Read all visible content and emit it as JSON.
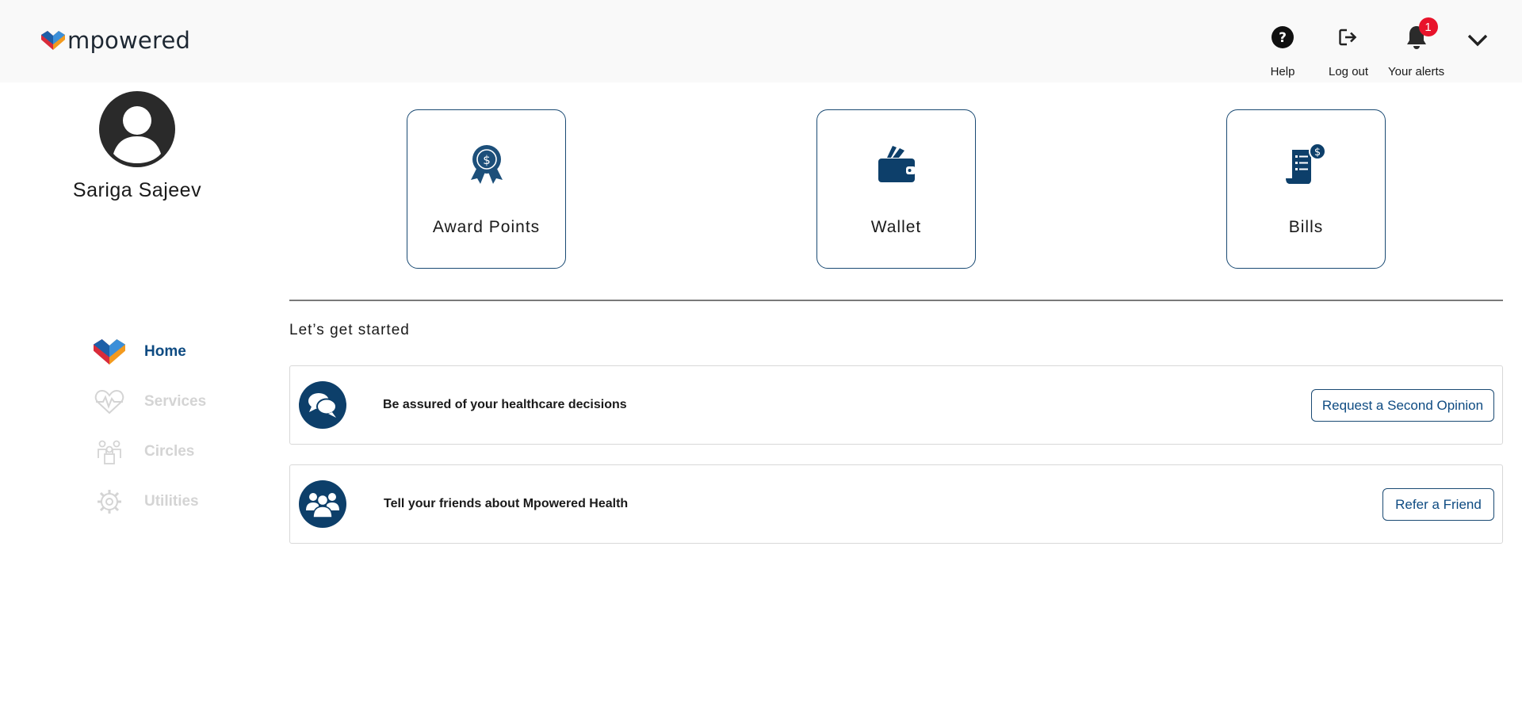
{
  "app": {
    "logo_text": "mpowered"
  },
  "header": {
    "help_label": "Help",
    "logout_label": "Log out",
    "alerts_label": "Your alerts",
    "alerts_count": "1"
  },
  "profile": {
    "name": "Sariga Sajeev"
  },
  "nav": {
    "items": [
      {
        "label": "Home",
        "icon": "heart-logo-icon",
        "active": true
      },
      {
        "label": "Services",
        "icon": "heart-pulse-icon",
        "active": false
      },
      {
        "label": "Circles",
        "icon": "people-icon",
        "active": false
      },
      {
        "label": "Utilities",
        "icon": "gear-icon",
        "active": false
      }
    ]
  },
  "tiles": [
    {
      "label": "Award Points",
      "icon": "award-ribbon-icon"
    },
    {
      "label": "Wallet",
      "icon": "wallet-icon"
    },
    {
      "label": "Bills",
      "icon": "bill-dollar-icon"
    }
  ],
  "main": {
    "section_title": "Let’s get started",
    "cards": [
      {
        "text": "Be assured of your healthcare decisions",
        "button": "Request a Second Opinion",
        "icon": "chat-bubbles-icon"
      },
      {
        "text": "Tell your friends about Mpowered Health",
        "button": "Refer a Friend",
        "icon": "group-icon"
      }
    ]
  },
  "colors": {
    "primary": "#0e4b82",
    "navy": "#0d3f6a",
    "alert": "#e8132b",
    "header_bg": "#f9f9f9",
    "inactive": "#d4d4d4"
  }
}
